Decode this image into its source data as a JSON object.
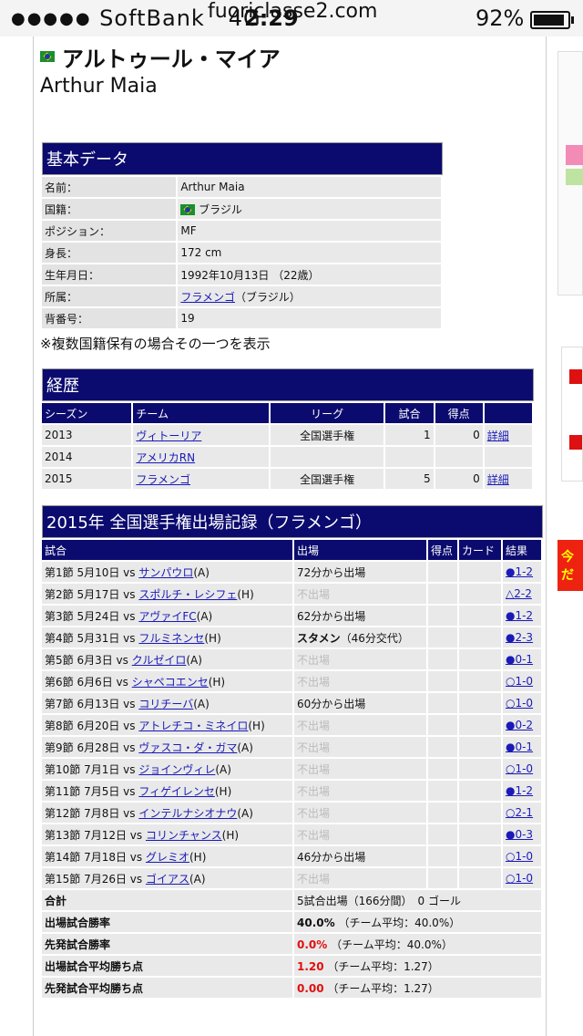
{
  "status": {
    "carrier": "SoftBank",
    "network": "4G",
    "time": "2:29",
    "url": "fuoriclasse2.com",
    "battery": "92%",
    "battery_level": 0.92
  },
  "player": {
    "name_jp": "アルトゥール・マイア",
    "name_en": "Arthur Maia"
  },
  "basic": {
    "title": "基本データ",
    "rows": [
      {
        "label": "名前：",
        "value": "Arthur Maia"
      },
      {
        "label": "国籍：",
        "value": "ブラジル"
      },
      {
        "label": "ポジション：",
        "value": "MF"
      },
      {
        "label": "身長：",
        "value": "172 cm"
      },
      {
        "label": "生年月日：",
        "value": "1992年10月13日 （22歳）"
      },
      {
        "label": "所属：",
        "link": "フラメンゴ",
        "value": "（ブラジル）"
      },
      {
        "label": "背番号：",
        "value": "19"
      }
    ],
    "note": "※複数国籍保有の場合その一つを表示"
  },
  "career": {
    "title": "経歴",
    "headers": [
      "シーズン",
      "チーム",
      "リーグ",
      "試合",
      "得点",
      ""
    ],
    "rows": [
      {
        "season": "2013",
        "team": "ヴィトーリア",
        "league": "全国選手権",
        "games": "1",
        "goals": "0",
        "detail": "詳細"
      },
      {
        "season": "2014",
        "team": "アメリカRN",
        "league": "",
        "games": "",
        "goals": "",
        "detail": ""
      },
      {
        "season": "2015",
        "team": "フラメンゴ",
        "league": "全国選手権",
        "games": "5",
        "goals": "0",
        "detail": "詳細"
      }
    ]
  },
  "record": {
    "title": "2015年 全国選手権出場記録（フラメンゴ）",
    "headers": [
      "試合",
      "出場",
      "得点",
      "カード",
      "結果"
    ],
    "rows": [
      {
        "prefix": "第1節 5月10日 vs ",
        "opp": "サンパウロ",
        "ha": "(A)",
        "appear": "72分から出場",
        "appear_extra": "",
        "status": "normal",
        "result": "●1-2"
      },
      {
        "prefix": "第2節 5月17日 vs ",
        "opp": "スポルチ・レシフェ",
        "ha": "(H)",
        "appear": "不出場",
        "appear_extra": "",
        "status": "dim",
        "result": "△2-2"
      },
      {
        "prefix": "第3節 5月24日 vs ",
        "opp": "アヴァイFC",
        "ha": "(A)",
        "appear": "62分から出場",
        "appear_extra": "",
        "status": "normal",
        "result": "●1-2"
      },
      {
        "prefix": "第4節 5月31日 vs ",
        "opp": "フルミネンセ",
        "ha": "(H)",
        "appear": "スタメン",
        "appear_extra": "（46分交代）",
        "status": "bold",
        "result": "●2-3"
      },
      {
        "prefix": "第5節 6月3日 vs ",
        "opp": "クルゼイロ",
        "ha": "(A)",
        "appear": "不出場",
        "appear_extra": "",
        "status": "dim",
        "result": "●0-1"
      },
      {
        "prefix": "第6節 6月6日 vs ",
        "opp": "シャペコエンセ",
        "ha": "(H)",
        "appear": "不出場",
        "appear_extra": "",
        "status": "dim",
        "result": "○1-0"
      },
      {
        "prefix": "第7節 6月13日 vs ",
        "opp": "コリチーバ",
        "ha": "(A)",
        "appear": "60分から出場",
        "appear_extra": "",
        "status": "normal",
        "result": "○1-0"
      },
      {
        "prefix": "第8節 6月20日 vs ",
        "opp": "アトレチコ・ミネイロ",
        "ha": "(H)",
        "appear": "不出場",
        "appear_extra": "",
        "status": "dim",
        "result": "●0-2"
      },
      {
        "prefix": "第9節 6月28日 vs ",
        "opp": "ヴァスコ・ダ・ガマ",
        "ha": "(A)",
        "appear": "不出場",
        "appear_extra": "",
        "status": "dim",
        "result": "●0-1"
      },
      {
        "prefix": "第10節 7月1日 vs ",
        "opp": "ジョインヴィレ",
        "ha": "(A)",
        "appear": "不出場",
        "appear_extra": "",
        "status": "dim",
        "result": "○1-0"
      },
      {
        "prefix": "第11節 7月5日 vs ",
        "opp": "フィゲイレンセ",
        "ha": "(H)",
        "appear": "不出場",
        "appear_extra": "",
        "status": "dim",
        "result": "●1-2"
      },
      {
        "prefix": "第12節 7月8日 vs ",
        "opp": "インテルナシオナウ",
        "ha": "(A)",
        "appear": "不出場",
        "appear_extra": "",
        "status": "dim",
        "result": "○2-1"
      },
      {
        "prefix": "第13節 7月12日 vs ",
        "opp": "コリンチャンス",
        "ha": "(H)",
        "appear": "不出場",
        "appear_extra": "",
        "status": "dim",
        "result": "●0-3"
      },
      {
        "prefix": "第14節 7月18日 vs ",
        "opp": "グレミオ",
        "ha": "(H)",
        "appear": "46分から出場",
        "appear_extra": "",
        "status": "normal",
        "result": "○1-0"
      },
      {
        "prefix": "第15節 7月26日 vs ",
        "opp": "ゴイアス",
        "ha": "(A)",
        "appear": "不出場",
        "appear_extra": "",
        "status": "dim",
        "result": "○1-0"
      }
    ],
    "summary": [
      {
        "label": "合計",
        "value": "5試合出場（166分間）　0 ゴール",
        "emph": "",
        "cls": ""
      },
      {
        "label": "出場試合勝率",
        "emph": "40.0%",
        "value": "（チーム平均：40.0%）",
        "cls": "bold"
      },
      {
        "label": "先発試合勝率",
        "emph": "0.0%",
        "value": "（チーム平均：40.0%）",
        "cls": "red"
      },
      {
        "label": "出場試合平均勝ち点",
        "emph": "1.20",
        "value": "（チーム平均：1.27）",
        "cls": "red"
      },
      {
        "label": "先発試合平均勝ち点",
        "emph": "0.00",
        "value": "（チーム平均：1.27）",
        "cls": "red"
      }
    ]
  },
  "ads": {
    "banner_text": "今だ"
  }
}
